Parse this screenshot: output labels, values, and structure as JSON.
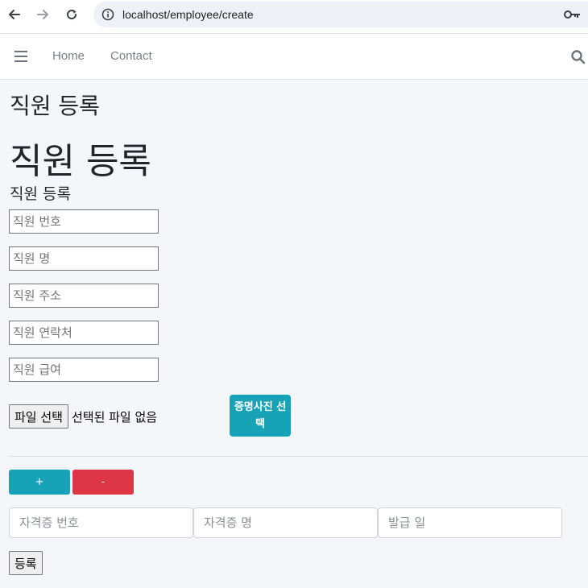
{
  "browser": {
    "url": "localhost/employee/create"
  },
  "navbar": {
    "links": [
      {
        "label": "Home"
      },
      {
        "label": "Contact"
      }
    ]
  },
  "page": {
    "title": "직원 등록",
    "heading": "직원 등록",
    "legend": "직원 등록"
  },
  "form": {
    "fields": [
      {
        "placeholder": "직원 번호",
        "value": ""
      },
      {
        "placeholder": "직원 명",
        "value": ""
      },
      {
        "placeholder": "직원 주소",
        "value": ""
      },
      {
        "placeholder": "직원 연락처",
        "value": ""
      },
      {
        "placeholder": "직원 급여",
        "value": ""
      }
    ],
    "file": {
      "button_label": "파일 선택",
      "status": "선택된 파일 없음"
    },
    "photo_button_label": "증명사진 선택",
    "add_label": "+",
    "remove_label": "-",
    "cert_fields": [
      {
        "placeholder": "자격증 번호"
      },
      {
        "placeholder": "자격증 명"
      },
      {
        "placeholder": "발급 일"
      }
    ],
    "submit_label": "등록"
  },
  "colors": {
    "info": "#17a2b8",
    "danger": "#dc3545",
    "background": "#f5f6fa"
  }
}
